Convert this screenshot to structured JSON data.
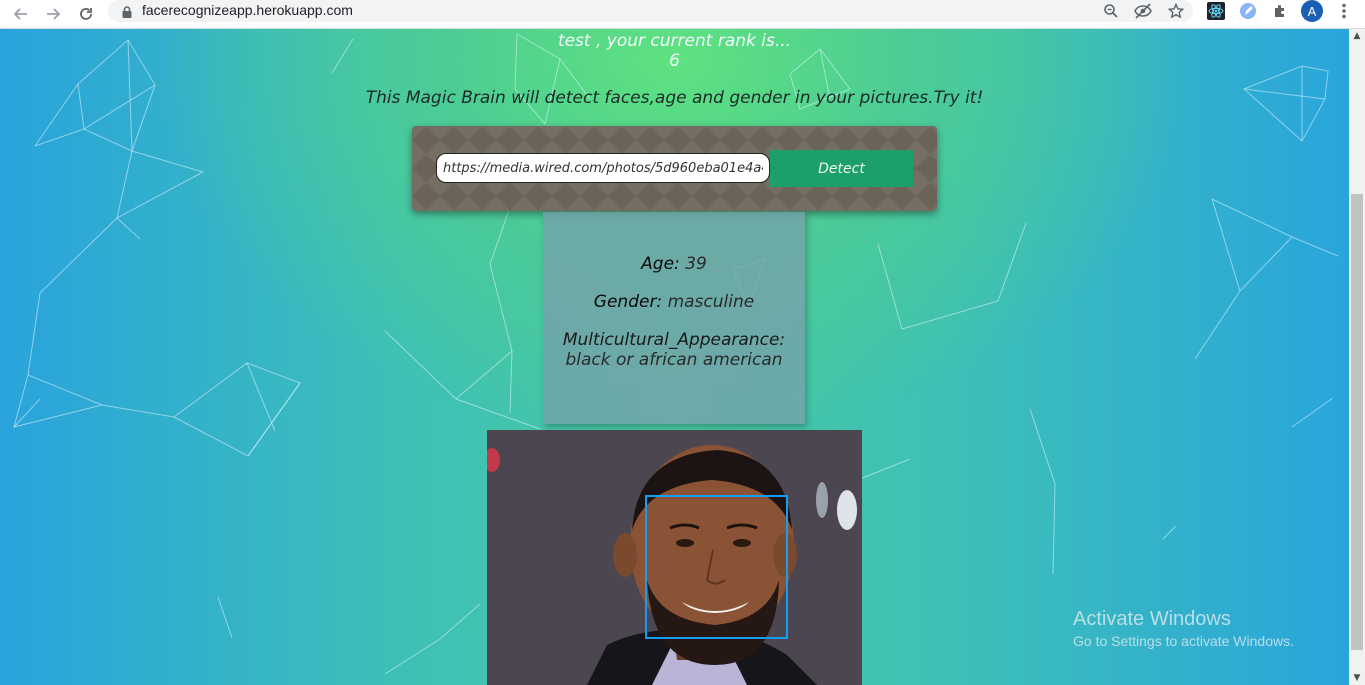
{
  "browser": {
    "url": "facerecognizeapp.herokuapp.com",
    "profile_initial": "A",
    "icons": {
      "back": "back-arrow-icon",
      "forward": "forward-arrow-icon",
      "reload": "reload-icon",
      "lock": "lock-icon",
      "zoom": "zoom-icon",
      "tracking": "eye-off-icon",
      "bookmark": "star-icon",
      "extensions": "puzzle-icon",
      "menu": "kebab-menu-icon"
    }
  },
  "header": {
    "rank_text": "test , your current rank is...",
    "rank_value": "6"
  },
  "tagline": "This Magic Brain will detect faces,age and gender in your pictures.Try it!",
  "form": {
    "image_url": "https://media.wired.com/photos/5d960eba01e4a4",
    "detect_label": "Detect"
  },
  "results": {
    "age_label": "Age:",
    "age_value": "39",
    "gender_label": "Gender:",
    "gender_value": "masculine",
    "appearance_label": "Multicultural_Appearance:",
    "appearance_value": "black or african american"
  },
  "watermark": {
    "title": "Activate Windows",
    "subtitle": "Go to Settings to activate Windows."
  },
  "colors": {
    "detect_button": "#1d9f6b",
    "face_box": "#149df2",
    "form_card": "#6b6357"
  }
}
